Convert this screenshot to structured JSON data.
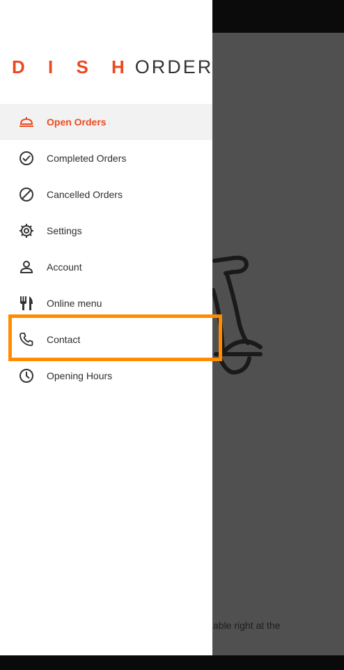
{
  "logo": {
    "brand_accent": "D I S H",
    "brand_rest": "ORDER"
  },
  "menu": {
    "items": [
      {
        "label": "Open Orders",
        "icon": "cloche-icon",
        "active": true
      },
      {
        "label": "Completed Orders",
        "icon": "check-circle-icon",
        "active": false
      },
      {
        "label": "Cancelled Orders",
        "icon": "ban-circle-icon",
        "active": false
      },
      {
        "label": "Settings",
        "icon": "gear-icon",
        "active": false
      },
      {
        "label": "Account",
        "icon": "person-icon",
        "active": false
      },
      {
        "label": "Online menu",
        "icon": "fork-knife-icon",
        "active": false
      },
      {
        "label": "Contact",
        "icon": "phone-icon",
        "active": false
      },
      {
        "label": "Opening Hours",
        "icon": "clock-icon",
        "active": false
      }
    ]
  },
  "background": {
    "footer_text": "able right at the"
  },
  "colors": {
    "accent": "#ea4a1f",
    "highlight": "#ff8c00",
    "overlay": "#505050"
  }
}
